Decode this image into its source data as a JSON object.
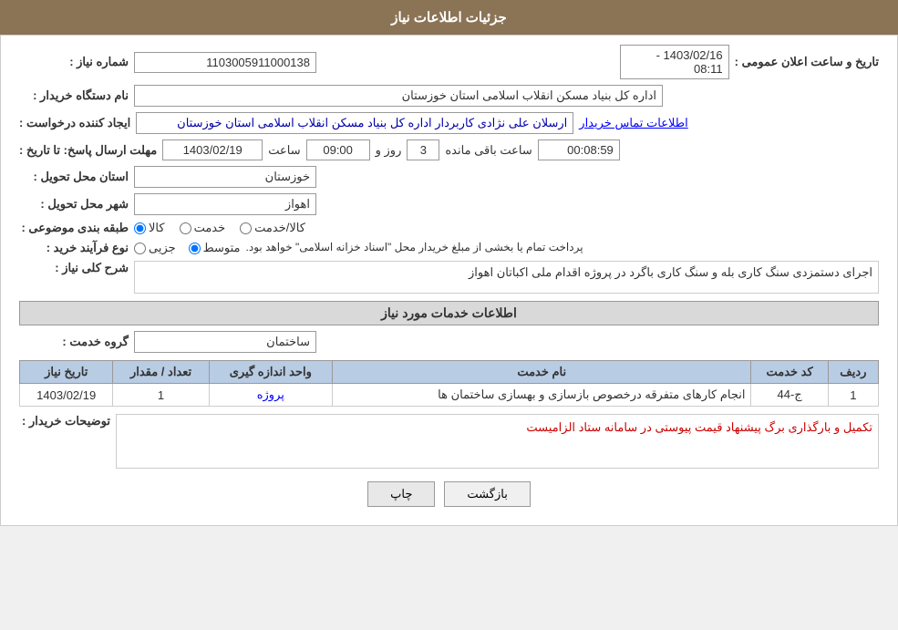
{
  "header": {
    "title": "جزئیات اطلاعات نیاز"
  },
  "fields": {
    "need_number_label": "شماره نیاز :",
    "need_number_value": "1103005911000138",
    "announce_datetime_label": "تاریخ و ساعت اعلان عمومی :",
    "announce_datetime_value": "1403/02/16 - 08:11",
    "buyer_org_label": "نام دستگاه خریدار :",
    "buyer_org_value": "اداره کل بنیاد مسکن انقلاب اسلامی استان خوزستان",
    "creator_label": "ایجاد کننده درخواست :",
    "creator_value": "ارسلان علی نژادی کاربردار اداره کل بنیاد مسکن انقلاب اسلامی استان خوزستان",
    "contact_link": "اطلاعات تماس خریدار",
    "reply_deadline_label": "مهلت ارسال پاسخ: تا تاریخ :",
    "reply_date": "1403/02/19",
    "reply_time_label": "ساعت",
    "reply_time": "09:00",
    "reply_days_label": "روز و",
    "reply_days": "3",
    "reply_remaining_label": "ساعت باقی مانده",
    "reply_remaining": "00:08:59",
    "province_label": "استان محل تحویل :",
    "province_value": "خوزستان",
    "city_label": "شهر محل تحویل :",
    "city_value": "اهواز",
    "category_label": "طبقه بندی موضوعی :",
    "category_options": [
      "کالا",
      "خدمت",
      "کالا/خدمت"
    ],
    "category_selected": "کالا",
    "purchase_type_label": "نوع فرآیند خرید :",
    "purchase_type_options": [
      "جزیی",
      "متوسط"
    ],
    "purchase_type_selected": "متوسط",
    "purchase_type_note": "پرداخت تمام یا بخشی از مبلغ خریدار محل \"اسناد خزانه اسلامی\" خواهد بود.",
    "description_label": "شرح کلی نیاز :",
    "description_value": "اجرای دستمزدی سنگ کاری بله  و سنگ کاری باگرد  در  پروژه  اقدام ملی اکباتان اهواز",
    "services_section_title": "اطلاعات خدمات مورد نیاز",
    "service_group_label": "گروه خدمت :",
    "service_group_value": "ساختمان",
    "table": {
      "columns": [
        "ردیف",
        "کد خدمت",
        "نام خدمت",
        "واحد اندازه گیری",
        "تعداد / مقدار",
        "تاریخ نیاز"
      ],
      "rows": [
        {
          "row": "1",
          "code": "ج-44",
          "name": "انجام کارهای متفرقه درخصوص بازسازی و بهسازی ساختمان ها",
          "unit": "پروژه",
          "quantity": "1",
          "date": "1403/02/19"
        }
      ]
    },
    "buyer_description_label": "توضیحات خریدار :",
    "buyer_description_value": "تکمیل و بارگذاری برگ پیشنهاد قیمت پیوستی در سامانه ستاد الزامیست"
  },
  "buttons": {
    "print": "چاپ",
    "back": "بازگشت"
  }
}
